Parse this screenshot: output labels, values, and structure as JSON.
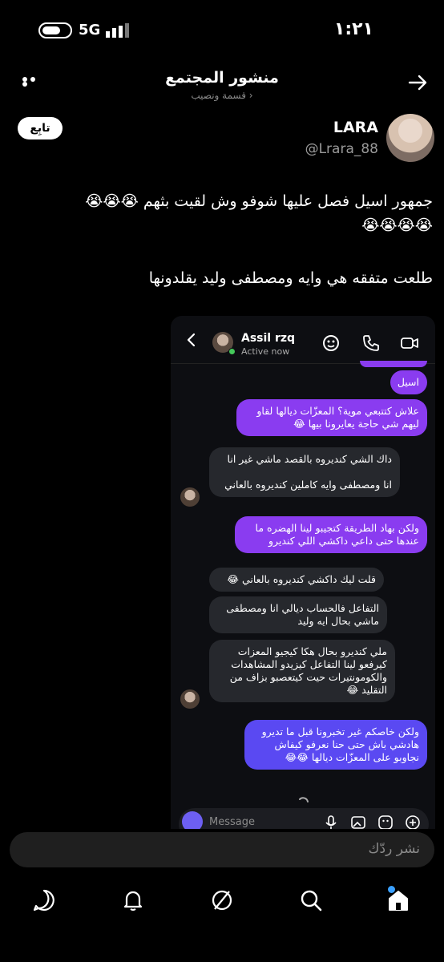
{
  "status_bar": {
    "time": "١:٢١",
    "network": "5G",
    "icons": [
      "battery-icon",
      "signal-icon"
    ]
  },
  "header": {
    "title": "منشور المجتمع",
    "subtitle": "قسمة ونصيب ›",
    "icons": [
      "more-icon",
      "back-arrow-icon"
    ]
  },
  "post": {
    "author_name": "LARA",
    "author_handle": "@Lrara_88",
    "follow_label": "تابِع",
    "lines": [
      "جمهور اسيل فصل عليها شوفو وش لقيت بثهم 😭😭😭",
      "😭😭😭😭",
      "طلعت متفقه هي وايه ومصطفى وليد يقلدونها"
    ]
  },
  "screenshot_chat": {
    "contact_name": "Assil rzq",
    "contact_status": "Active now",
    "header_icons": [
      "back-chevron-icon",
      "video-effect-icon",
      "phone-icon",
      "video-camera-icon"
    ],
    "messages": [
      {
        "side": "sent",
        "text": "اسيل"
      },
      {
        "side": "sent",
        "text": "علاش كتتبعي موية؟ المعزّات ديالها لقاو\nليهم شي حاجة يعايرونا بيها 😂"
      },
      {
        "side": "received",
        "text": "داك الشي كنديروه بالقصد ماشي غير انا\n\nانا ومصطفى وايه كاملين كنديروه بالعاني"
      },
      {
        "side": "sent",
        "text": "ولكن بهاد الطريقة كتجيبو لينا الهضره ما\nعندها حتى داعي داكشي اللي كنديرو"
      },
      {
        "side": "received",
        "text": "قلت ليك داكشي كنديروه بالعاني 😂"
      },
      {
        "side": "received",
        "text": "التفاعل فالحساب ديالي انا ومصطفى\nماشي بحال ايه وليد"
      },
      {
        "side": "received",
        "text": "ملي كنديرو بحال هكا كيجيو المعزات\nكيرفعو لينا التفاعل كيزيدو المشاهدات\nوالكومونتيرات حيت كيتعصبو بزاف من\nالتقليد 😂"
      },
      {
        "side": "sent",
        "text": "ولكن خاصكم غير تخبرونا قبل ما تديرو\nهادشي باش حتى حنا نعرفو كيفاش\nنجاوبو على المعزّات ديالها 😂😂"
      }
    ],
    "composer_placeholder": "Message",
    "composer_icons": [
      "camera-icon",
      "mic-icon",
      "gallery-icon",
      "sticker-icon",
      "plus-icon"
    ]
  },
  "reply": {
    "placeholder": "نشر ردّك"
  },
  "tabbar": {
    "tabs": [
      "chat-tab",
      "notifications-tab",
      "explore-tab",
      "search-tab",
      "home-tab"
    ]
  },
  "colors": {
    "sent_purple": "#8a3cf0",
    "sent_blue": "#5a49f2",
    "received": "#26282d",
    "accent": "#3aa0ff"
  }
}
